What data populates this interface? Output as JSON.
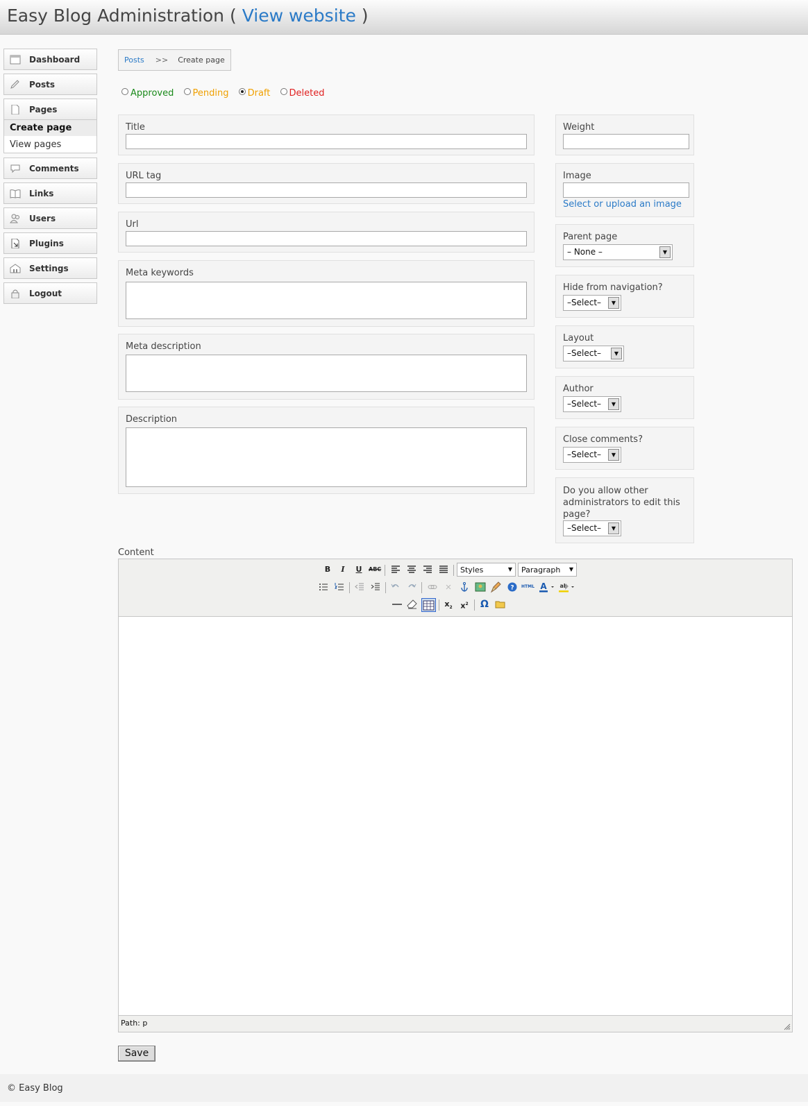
{
  "header": {
    "title": "Easy Blog Administration",
    "open_paren": "(",
    "link": "View website",
    "close_paren": ")"
  },
  "sidebar": {
    "items": [
      {
        "label": "Dashboard",
        "icon": "window-icon"
      },
      {
        "label": "Posts",
        "icon": "pencil-icon"
      },
      {
        "label": "Pages",
        "icon": "page-icon"
      },
      {
        "label": "Comments",
        "icon": "speech-bubble-icon"
      },
      {
        "label": "Links",
        "icon": "book-icon"
      },
      {
        "label": "Users",
        "icon": "users-icon"
      },
      {
        "label": "Plugins",
        "icon": "plugin-icon"
      },
      {
        "label": "Settings",
        "icon": "settings-icon"
      },
      {
        "label": "Logout",
        "icon": "lock-icon"
      }
    ],
    "pages_sub": [
      "Create page",
      "View pages"
    ]
  },
  "breadcrumb": {
    "root": "Posts",
    "separator": ">>",
    "current": "Create page"
  },
  "status": {
    "options": [
      {
        "label": "Approved",
        "color": "#1a8a1a"
      },
      {
        "label": "Pending",
        "color": "#f0a000"
      },
      {
        "label": "Draft",
        "color": "#f0a000"
      },
      {
        "label": "Deleted",
        "color": "#e02020"
      }
    ],
    "selected": "Draft"
  },
  "fields": {
    "title": "Title",
    "url_tag": "URL tag",
    "url": "Url",
    "meta_keywords": "Meta keywords",
    "meta_description": "Meta description",
    "description": "Description"
  },
  "side_fields": {
    "weight": "Weight",
    "image": "Image",
    "image_link": "Select or upload an image",
    "parent_page": "Parent page",
    "parent_page_value": "– None –",
    "hide_nav": "Hide from navigation?",
    "layout": "Layout",
    "author": "Author",
    "close_comments": "Close comments?",
    "allow_admins": "Do you allow other administrators to edit this page?",
    "select_value": "–Select–"
  },
  "editor": {
    "label": "Content",
    "styles": "Styles",
    "format": "Paragraph",
    "path": "Path: p"
  },
  "save_label": "Save",
  "footer": "© Easy Blog"
}
